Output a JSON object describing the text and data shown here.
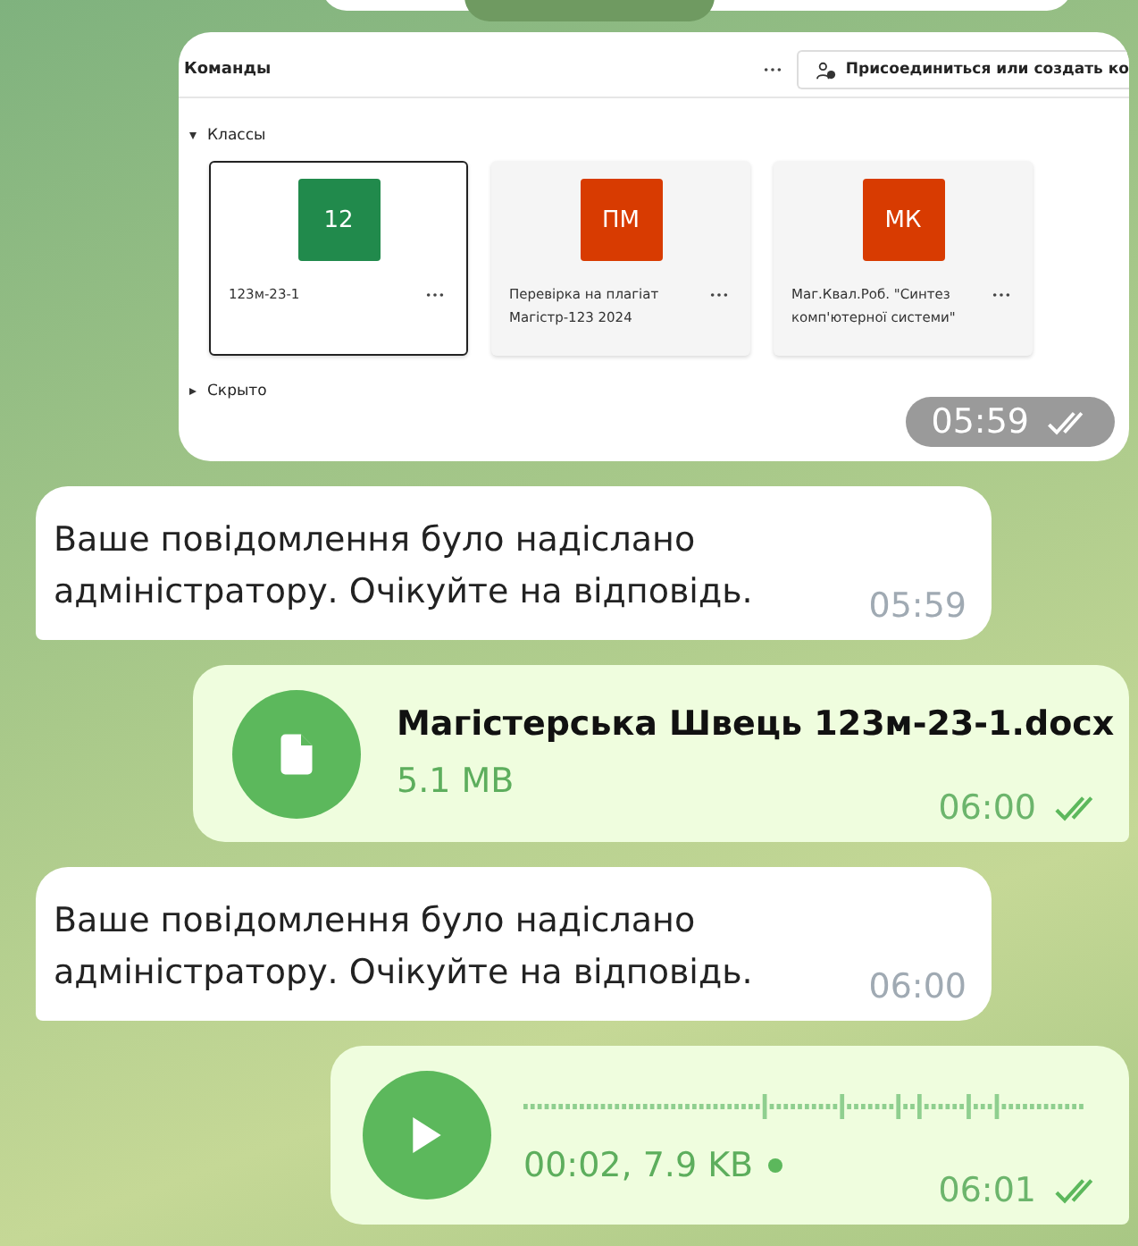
{
  "teams_screenshot": {
    "title": "Команды",
    "join_button": "Присоединиться или создать ко",
    "sections": [
      {
        "label": "Классы",
        "expanded": true
      },
      {
        "label": "Скрыто",
        "expanded": false
      }
    ],
    "cards": [
      {
        "tile": "12",
        "name": "123м-23-1",
        "color": "#218a4c",
        "selected": true
      },
      {
        "tile": "ПМ",
        "name": "Перевірка на плагіат Магістр-123 2024",
        "color": "#d83b01",
        "selected": false
      },
      {
        "tile": "МК",
        "name": "Маг.Квал.Роб. \"Синтез комп'ютерної системи\"",
        "color": "#d83b01",
        "selected": false
      }
    ],
    "time": "05:59",
    "read": true
  },
  "messages": [
    {
      "kind": "text",
      "outgoing": false,
      "text": "Ваше повідомлення було надіслано адміністратору. Очікуйте на відповідь.",
      "time": "05:59"
    },
    {
      "kind": "file",
      "outgoing": true,
      "file_name": "Магістерська Швець 123м-23-1.docx",
      "size": "5.1 MB",
      "time": "06:00",
      "read": true
    },
    {
      "kind": "text",
      "outgoing": false,
      "text": "Ваше повідомлення було надіслано адміністратору. Очікуйте на відповідь.",
      "time": "06:00"
    },
    {
      "kind": "voice",
      "outgoing": true,
      "info": "00:02, 7.9 KB",
      "unlistened": true,
      "time": "06:01",
      "read": true
    }
  ]
}
